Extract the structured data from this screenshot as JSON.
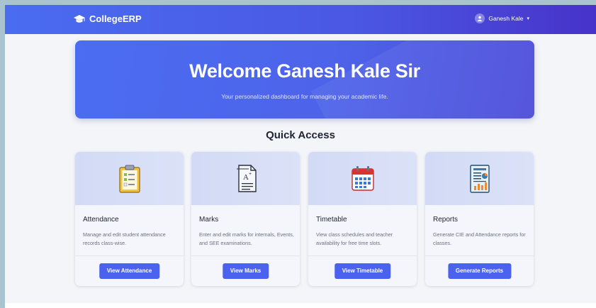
{
  "navbar": {
    "brand": "CollegeERP",
    "brand_icon": "graduation-cap-icon",
    "user_name": "Ganesh Kale",
    "user_icon": "user-icon",
    "caret": "▾"
  },
  "hero": {
    "title": "Welcome Ganesh Kale Sir",
    "subtitle": "Your personalized dashboard for managing your academic life."
  },
  "quick_access": {
    "title": "Quick Access",
    "cards": [
      {
        "title": "Attendance",
        "description": "Manage and edit student attendance records class-wise.",
        "button": "View Attendance",
        "icon": "clipboard-checklist-icon"
      },
      {
        "title": "Marks",
        "description": "Enter and edit marks for internals, Events, and SEE examinations.",
        "button": "View Marks",
        "icon": "grade-document-icon"
      },
      {
        "title": "Timetable",
        "description": "View class schedules and teacher availability for free time slots.",
        "button": "View Timetable",
        "icon": "calendar-icon"
      },
      {
        "title": "Reports",
        "description": "Generate CIE and Attendance reports for classes.",
        "button": "Generate Reports",
        "icon": "report-chart-icon"
      }
    ]
  },
  "colors": {
    "navbar_start": "#4a6cf0",
    "navbar_end": "#4733c9",
    "hero": "#4d63ea",
    "button": "#4a62ee"
  }
}
